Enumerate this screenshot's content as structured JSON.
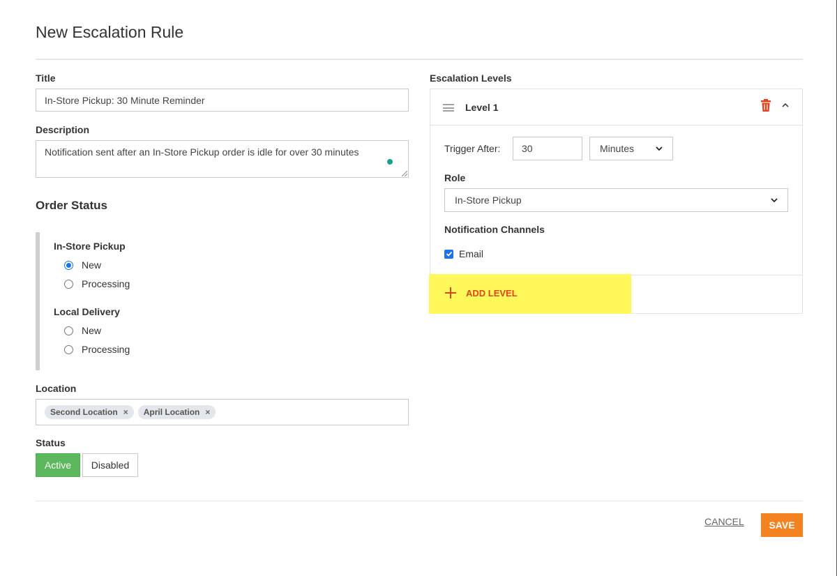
{
  "header": {
    "title": "New Escalation Rule"
  },
  "form": {
    "title_label": "Title",
    "title_value": "In-Store Pickup: 30 Minute Reminder",
    "description_label": "Description",
    "description_value": "Notification sent after an In-Store Pickup order is idle for over 30 minutes",
    "order_status_heading": "Order Status",
    "groups": [
      {
        "label": "In-Store Pickup",
        "options": [
          {
            "label": "New",
            "checked": true
          },
          {
            "label": "Processing",
            "checked": false
          }
        ]
      },
      {
        "label": "Local Delivery",
        "options": [
          {
            "label": "New",
            "checked": false
          },
          {
            "label": "Processing",
            "checked": false
          }
        ]
      }
    ],
    "location_label": "Location",
    "locations": [
      "Second Location",
      "April Location"
    ],
    "tag_remove": "×",
    "status_label": "Status",
    "status_active": "Active",
    "status_disabled": "Disabled"
  },
  "escalation": {
    "heading": "Escalation Levels",
    "level_title": "Level 1",
    "trigger_label": "Trigger After:",
    "trigger_value": "30",
    "trigger_unit": "Minutes",
    "role_label": "Role",
    "role_value": "In-Store Pickup",
    "channels_label": "Notification Channels",
    "channel_email": "Email",
    "channel_email_checked": true,
    "add_level": "ADD LEVEL"
  },
  "footer": {
    "cancel": "CANCEL",
    "save": "SAVE"
  },
  "colors": {
    "accent_save": "#f58220",
    "active_green": "#5cb85c",
    "add_level_red": "#e0441c",
    "highlight_yellow": "#fff85a",
    "radio_blue": "#1a73e8"
  }
}
